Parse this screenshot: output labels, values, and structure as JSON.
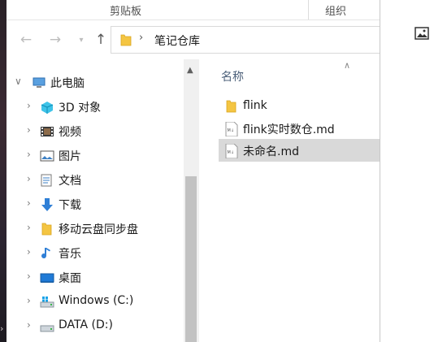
{
  "ribbon": {
    "group_clipboard": "剪贴板",
    "group_organize": "组织"
  },
  "address": {
    "path": "笔记仓库"
  },
  "nav_tree": [
    {
      "label": "此电脑",
      "icon": "computer-icon",
      "expanded": true
    },
    {
      "label": "3D 对象",
      "icon": "3d-objects-icon"
    },
    {
      "label": "视频",
      "icon": "video-icon"
    },
    {
      "label": "图片",
      "icon": "pictures-icon"
    },
    {
      "label": "文档",
      "icon": "documents-icon"
    },
    {
      "label": "下载",
      "icon": "download-icon"
    },
    {
      "label": "移动云盘同步盘",
      "icon": "folder-icon"
    },
    {
      "label": "音乐",
      "icon": "music-icon"
    },
    {
      "label": "桌面",
      "icon": "desktop-icon"
    },
    {
      "label": "Windows (C:)",
      "icon": "windows-drive-icon"
    },
    {
      "label": "DATA (D:)",
      "icon": "drive-icon"
    }
  ],
  "content": {
    "column_name": "名称",
    "files": [
      {
        "name": "flink",
        "icon": "folder-icon",
        "selected": false
      },
      {
        "name": "flink实时数仓.md",
        "icon": "markdown-file-icon",
        "selected": false
      },
      {
        "name": "未命名.md",
        "icon": "markdown-file-icon",
        "selected": true
      }
    ]
  },
  "colors": {
    "accent_folder": "#f4c542",
    "selection": "#d9d9d9",
    "header_text": "#4c607a"
  }
}
